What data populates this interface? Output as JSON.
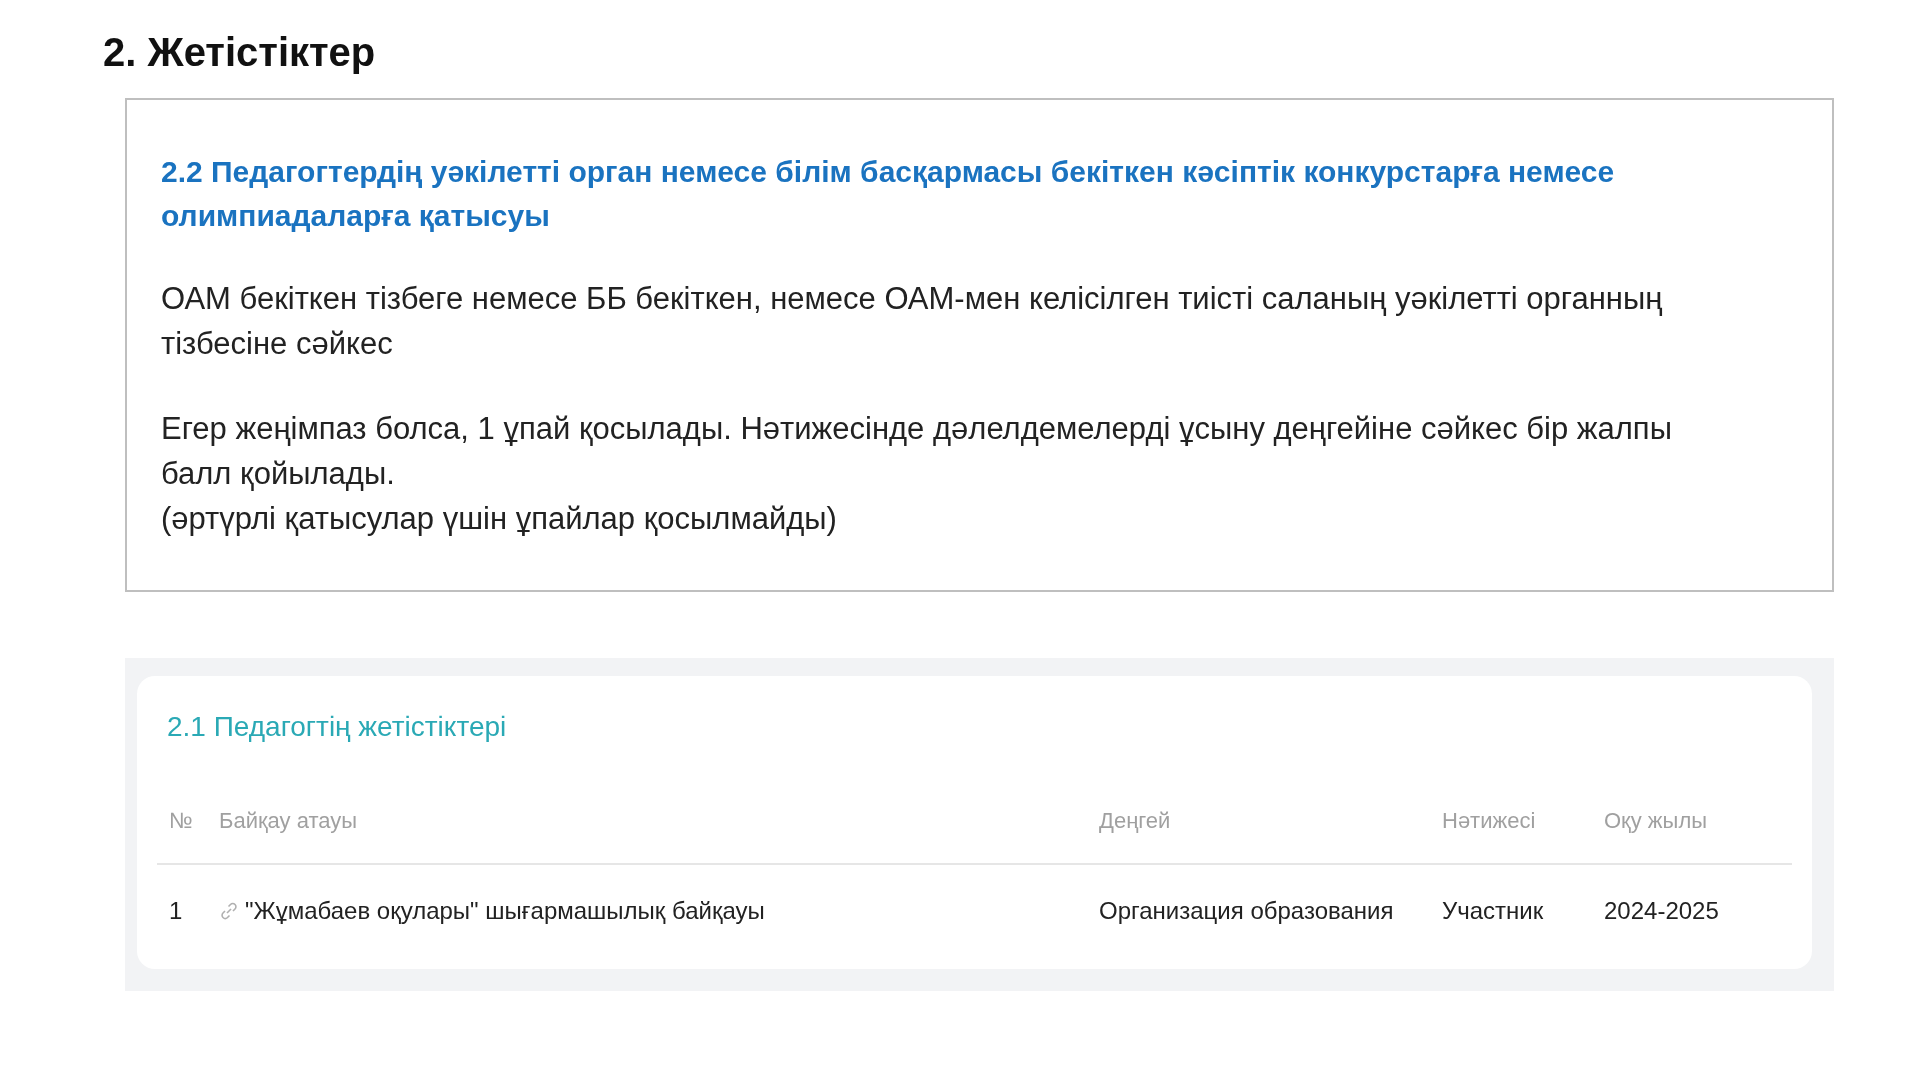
{
  "title": "2. Жетістіктер",
  "info_box": {
    "heading": "2.2 Педагогтердің уәкілетті орган немесе білім басқармасы бекіткен кәсіптік конкурстарға немесе олимпиадаларға қатысуы",
    "paragraphs": [
      "ОАМ бекіткен тізбеге немесе ББ бекіткен, немесе ОАМ-мен келісілген тиісті саланың уәкілетті органның тізбесіне  сәйкес",
      "Егер жеңімпаз болса, 1 ұпай қосылады. Нәтижесінде дәлелдемелерді ұсыну деңгейіне сәйкес бір жалпы балл қойылады.\n(әртүрлі қатысулар үшін ұпайлар қосылмайды)"
    ]
  },
  "screenshot": {
    "heading": "2.1 Педагогтің жетістіктері",
    "table": {
      "columns": [
        "№",
        "Байқау атауы",
        "Деңгей",
        "Нәтижесі",
        "Оқу жылы"
      ],
      "rows": [
        {
          "cells": [
            "1",
            "\"Жұмабаев оқулары\" шығармашылық байқауы",
            "Организация образования",
            "Участник",
            "2024-2025"
          ],
          "has_link": true
        }
      ]
    }
  }
}
